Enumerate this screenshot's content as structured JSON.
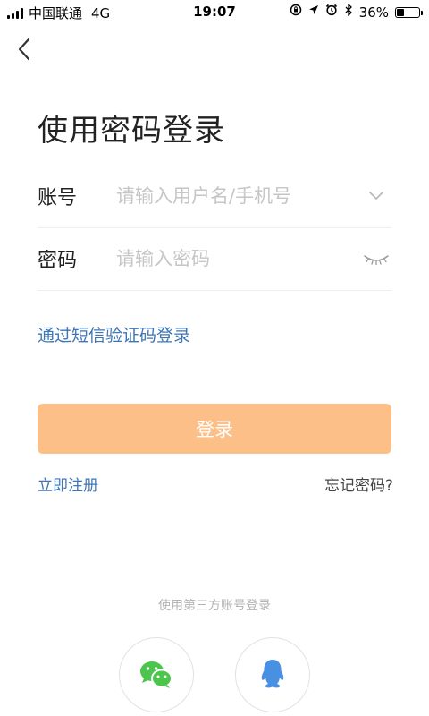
{
  "status_bar": {
    "carrier": "中国联通",
    "network": "4G",
    "time": "19:07",
    "battery": "36%",
    "battery_level": 0.36,
    "icons": [
      "signal-icon",
      "screen-lock-icon",
      "location-icon",
      "alarm-icon",
      "bluetooth-icon",
      "battery-icon"
    ]
  },
  "header": {
    "back_icon": "chevron-left-icon"
  },
  "title": "使用密码登录",
  "form": {
    "account_label": "账号",
    "account_placeholder": "请输入用户名/手机号",
    "account_value": "",
    "account_dropdown_icon": "chevron-down-icon",
    "password_label": "密码",
    "password_placeholder": "请输入密码",
    "password_value": "",
    "password_toggle_icon": "eye-closed-icon"
  },
  "links": {
    "sms_login": "通过短信验证码登录",
    "register": "立即注册",
    "forgot": "忘记密码?"
  },
  "login_button": "登录",
  "third_party": {
    "label": "使用第三方账号登录",
    "providers": [
      "wechat-icon",
      "qq-icon"
    ]
  },
  "colors": {
    "accent_link": "#3e76b5",
    "login_button_bg": "#fbbf87",
    "wechat_green": "#4bc54b",
    "qq_blue": "#4a90e2"
  }
}
